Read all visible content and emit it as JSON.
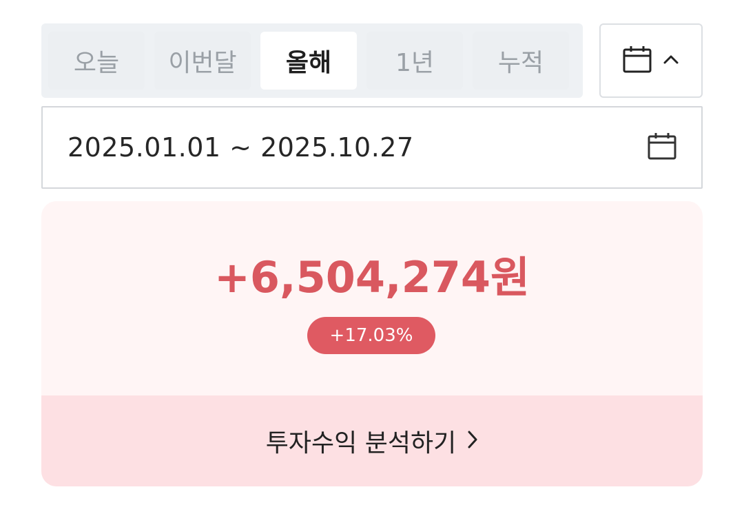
{
  "period_tabs": [
    {
      "label": "오늘",
      "active": false
    },
    {
      "label": "이번달",
      "active": false
    },
    {
      "label": "올해",
      "active": true
    },
    {
      "label": "1년",
      "active": false
    },
    {
      "label": "누적",
      "active": false
    }
  ],
  "calendar_toggle": {
    "icon": "calendar-icon",
    "chevron": "chevron-up-icon"
  },
  "date_range": {
    "text": "2025.01.01 ~ 2025.10.27",
    "icon": "calendar-icon"
  },
  "profit": {
    "amount": "+6,504,274원",
    "rate": "+17.03%",
    "color": "#d9585f"
  },
  "analysis_link": {
    "label": "투자수익 분석하기",
    "icon": "chevron-right-icon"
  },
  "colors": {
    "accent": "#df5a62",
    "card_bg": "#fff5f5",
    "footer_bg": "#fde0e3",
    "tabbar_bg": "#eef1f4"
  }
}
